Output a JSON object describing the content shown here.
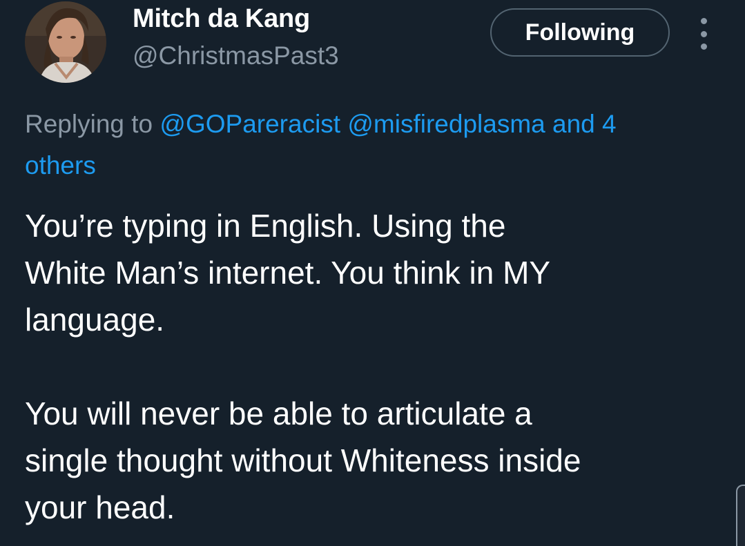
{
  "author": {
    "display_name": "Mitch da Kang",
    "handle": "@ChristmasPast3",
    "avatar_icon": "profile-photo"
  },
  "follow_button": {
    "label": "Following"
  },
  "more_menu": {
    "icon": "vertical-ellipsis-icon"
  },
  "reply_context": {
    "prefix": "Replying to",
    "mention_1": "@GOPareracist",
    "mention_2": "@misfiredplasma",
    "others_part_1": "and 4",
    "others_part_2": "others"
  },
  "tweet": {
    "paragraph_1": "You’re typing in English. Using the\nWhite Man’s internet. You think in MY\nlanguage.",
    "paragraph_2": "You will never be able to articulate a\nsingle thought without Whiteness inside\nyour head."
  },
  "colors": {
    "background": "#15202b",
    "link": "#1d9bf0",
    "secondary_text": "#8b98a5",
    "primary_text": "#ffffff"
  }
}
